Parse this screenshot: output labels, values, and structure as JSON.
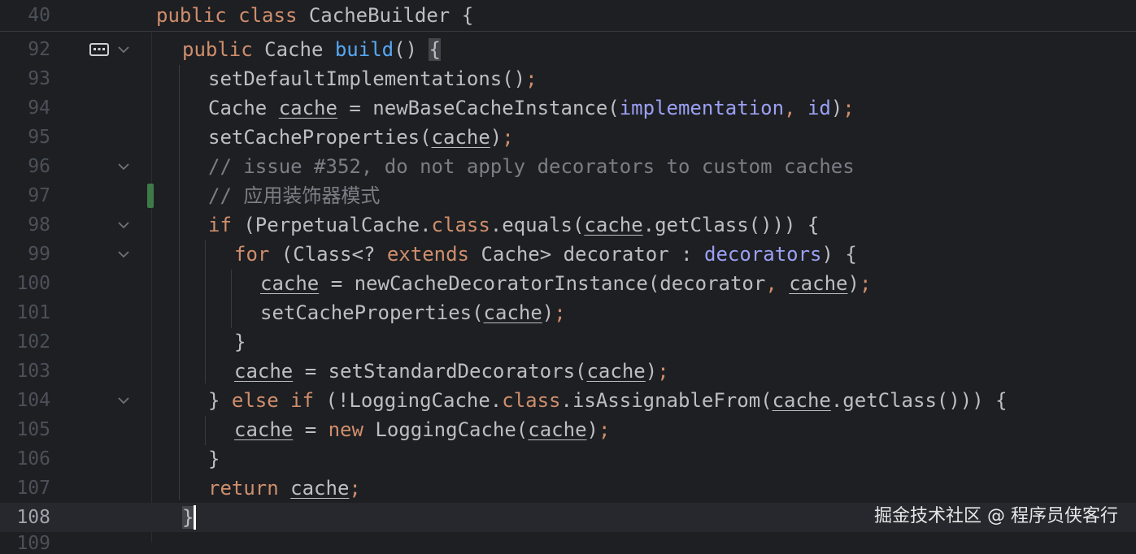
{
  "sticky": {
    "line_number": "40",
    "code": [
      "public",
      "class",
      "CacheBuilder {"
    ]
  },
  "lines": [
    {
      "num": "92"
    },
    {
      "num": "93"
    },
    {
      "num": "94"
    },
    {
      "num": "95"
    },
    {
      "num": "96"
    },
    {
      "num": "97"
    },
    {
      "num": "98"
    },
    {
      "num": "99"
    },
    {
      "num": "100"
    },
    {
      "num": "101"
    },
    {
      "num": "102"
    },
    {
      "num": "103"
    },
    {
      "num": "104"
    },
    {
      "num": "105"
    },
    {
      "num": "106"
    },
    {
      "num": "107"
    },
    {
      "num": "108"
    }
  ],
  "text": {
    "l92_kw": "public",
    "l92_a": "Cache",
    "l92_fn": "build",
    "l92_b": "() ",
    "l92_brace": "{",
    "l93": "setDefaultImplementations()",
    "l93_semi": ";",
    "l94_a": "Cache",
    "l94_var": "cache",
    "l94_b": " = newBaseCacheInstance(",
    "l94_f1": "implementation",
    "l94_c": ", ",
    "l94_f2": "id",
    "l94_d": ")",
    "l94_semi": ";",
    "l95_a": "setCacheProperties(",
    "l95_var": "cache",
    "l95_b": ")",
    "l95_semi": ";",
    "l96": "// issue #352, do not apply decorators to custom caches",
    "l97": "// 应用装饰器模式",
    "l98_kw": "if",
    "l98_a": " (PerpetualCache.",
    "l98_kw2": "class",
    "l98_b": ".equals(",
    "l98_var": "cache",
    "l98_c": ".getClass())) {",
    "l99_kw": "for",
    "l99_a": " (Class<? ",
    "l99_kw2": "extends",
    "l99_b": " Cache> decorator : ",
    "l99_fld": "decorators",
    "l99_c": ") {",
    "l100_var1": "cache",
    "l100_a": " = newCacheDecoratorInstance(decorator",
    "l100_comma": ", ",
    "l100_var2": "cache",
    "l100_b": ")",
    "l100_semi": ";",
    "l101_a": "setCacheProperties(",
    "l101_var": "cache",
    "l101_b": ")",
    "l101_semi": ";",
    "l102": "}",
    "l103_var1": "cache",
    "l103_a": " = setStandardDecorators(",
    "l103_var2": "cache",
    "l103_b": ")",
    "l103_semi": ";",
    "l104_a": "} ",
    "l104_kw": "else if",
    "l104_b": " (!LoggingCache.",
    "l104_kw2": "class",
    "l104_c": ".isAssignableFrom(",
    "l104_var": "cache",
    "l104_d": ".getClass())) {",
    "l105_var1": "cache",
    "l105_a": " = ",
    "l105_kw": "new",
    "l105_b": " LoggingCache(",
    "l105_var2": "cache",
    "l105_c": ")",
    "l105_semi": ";",
    "l106": "}",
    "l107_kw": "return",
    "l107_var": "cache",
    "l107_semi": ";",
    "l108": "}"
  },
  "watermark": "掘金技术社区 @ 程序员侠客行",
  "next_line_peek": "109",
  "colors": {
    "background": "#1e1f22",
    "keyword": "#cf8e6d",
    "field": "#9ba0f4",
    "method_decl": "#56a8f5",
    "comment": "#7a7e85",
    "default_text": "#bcbec4",
    "change_marker": "#3e7a48"
  },
  "icons": {
    "fold": "chevron-down-icon",
    "breakpoint_type": "code-vision-icon"
  }
}
